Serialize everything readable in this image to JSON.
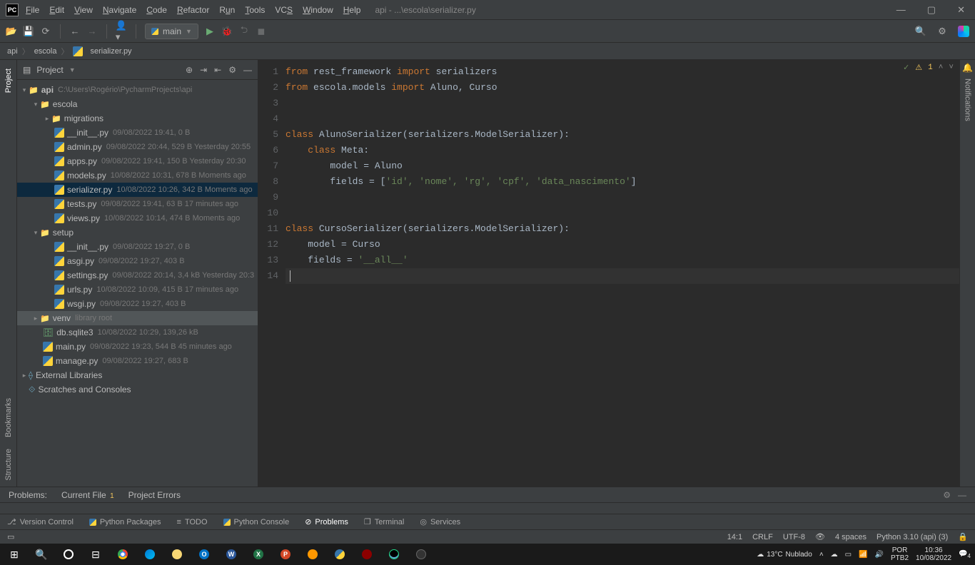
{
  "titlebar": {
    "logo": "PC",
    "menus": [
      "File",
      "Edit",
      "View",
      "Navigate",
      "Code",
      "Refactor",
      "Run",
      "Tools",
      "VCS",
      "Window",
      "Help"
    ],
    "path": "api - ...\\escola\\serializer.py"
  },
  "toolbar": {
    "run_config": "main"
  },
  "breadcrumbs": [
    "api",
    "escola",
    "serializer.py"
  ],
  "project_panel": {
    "title": "Project",
    "root": {
      "name": "api",
      "path": "C:\\Users\\Rogério\\PycharmProjects\\api"
    },
    "escola": {
      "name": "escola"
    },
    "migrations": {
      "name": "migrations"
    },
    "files_escola": [
      {
        "name": "__init__.py",
        "meta": "09/08/2022 19:41, 0 B"
      },
      {
        "name": "admin.py",
        "meta": "09/08/2022 20:44, 529 B Yesterday 20:55"
      },
      {
        "name": "apps.py",
        "meta": "09/08/2022 19:41, 150 B Yesterday 20:30"
      },
      {
        "name": "models.py",
        "meta": "10/08/2022 10:31, 678 B Moments ago"
      },
      {
        "name": "serializer.py",
        "meta": "10/08/2022 10:26, 342 B Moments ago",
        "selected": true
      },
      {
        "name": "tests.py",
        "meta": "09/08/2022 19:41, 63 B 17 minutes ago"
      },
      {
        "name": "views.py",
        "meta": "10/08/2022 10:14, 474 B Moments ago"
      }
    ],
    "setup": {
      "name": "setup"
    },
    "files_setup": [
      {
        "name": "__init__.py",
        "meta": "09/08/2022 19:27, 0 B"
      },
      {
        "name": "asgi.py",
        "meta": "09/08/2022 19:27, 403 B"
      },
      {
        "name": "settings.py",
        "meta": "09/08/2022 20:14, 3,4 kB Yesterday 20:3"
      },
      {
        "name": "urls.py",
        "meta": "10/08/2022 10:09, 415 B 17 minutes ago"
      },
      {
        "name": "wsgi.py",
        "meta": "09/08/2022 19:27, 403 B"
      }
    ],
    "venv": {
      "name": "venv",
      "hint": "library root"
    },
    "root_files": [
      {
        "name": "db.sqlite3",
        "meta": "10/08/2022 10:29, 139,26 kB",
        "icon": "db"
      },
      {
        "name": "main.py",
        "meta": "09/08/2022 19:23, 544 B 45 minutes ago"
      },
      {
        "name": "manage.py",
        "meta": "09/08/2022 19:27, 683 B"
      }
    ],
    "external": "External Libraries",
    "scratches": "Scratches and Consoles"
  },
  "left_tabs": [
    "Project",
    "Bookmarks",
    "Structure"
  ],
  "right_tabs": [
    "Notifications"
  ],
  "editor": {
    "lines": 14,
    "inspections": {
      "check": "✓",
      "warn": "1"
    },
    "code": {
      "l1": {
        "kw1": "from",
        "m1": " rest_framework ",
        "kw2": "import",
        "m2": " serializers"
      },
      "l2": {
        "kw1": "from",
        "m1": " escola.models ",
        "kw2": "import",
        "m2": " Aluno",
        "c": ",",
        "m3": " Curso"
      },
      "l5": {
        "kw1": "class",
        "m1": " AlunoSerializer(serializers.ModelSerializer):"
      },
      "l6": {
        "kw1": "class",
        "m1": " Meta:"
      },
      "l7": {
        "m1": "model = Aluno"
      },
      "l8": {
        "m1": "fields = [",
        "s": "'id', 'nome', 'rg', 'cpf', 'data_nascimento'",
        "m2": "]"
      },
      "l11": {
        "kw1": "class",
        "m1": " CursoSerializer(serializers.ModelSerializer):"
      },
      "l12": {
        "m1": "model = Curso"
      },
      "l13": {
        "m1": "fields = ",
        "s": "'__all__'"
      }
    }
  },
  "problems_band": {
    "problems": "Problems:",
    "current_file": "Current File",
    "current_count": "1",
    "project_errors": "Project Errors"
  },
  "bottom_tabs": {
    "vcs": "Version Control",
    "packages": "Python Packages",
    "todo": "TODO",
    "console": "Python Console",
    "problems": "Problems",
    "terminal": "Terminal",
    "services": "Services"
  },
  "status": {
    "pos": "14:1",
    "sep": "CRLF",
    "enc": "UTF-8",
    "indent": "4 spaces",
    "interpreter": "Python 3.10 (api) (3)"
  },
  "taskbar": {
    "weather_temp": "13°C",
    "weather_desc": "Nublado",
    "lang1": "POR",
    "lang2": "PTB2",
    "time": "10:36",
    "date": "10/08/2022",
    "notif": "4"
  }
}
